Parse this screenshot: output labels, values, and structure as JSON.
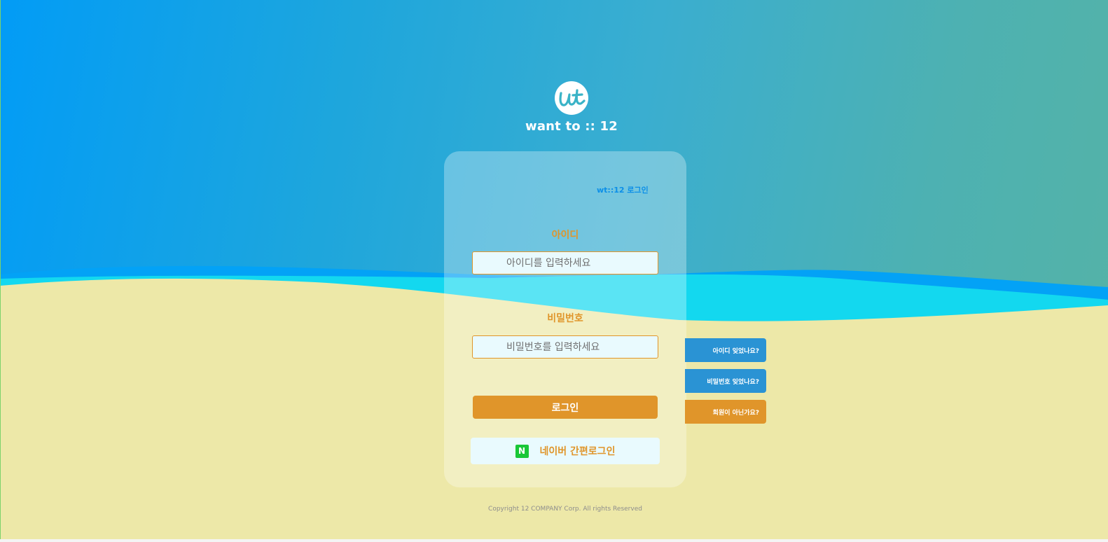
{
  "brand": {
    "logo_text": "wt",
    "name": "want to :: 12"
  },
  "login_card": {
    "title": "wt::12 로그인",
    "id_label": "아이디",
    "id_placeholder": "아이디를 입력하세요",
    "password_label": "비밀번호",
    "password_placeholder": "비밀번호를 입력하세요",
    "login_button": "로그인",
    "naver_icon": "N",
    "naver_button": "네이버 간편로그인"
  },
  "side_links": {
    "find_id": "아이디 잊었나요?",
    "find_password": "비밀번호 잊었나요?",
    "signup": "회원이 아닌가요?"
  },
  "footer": {
    "copyright": "Copyright 12 COMPANY Corp. All rights Reserved"
  },
  "colors": {
    "accent_orange": "#e0952a",
    "accent_blue": "#2a93d4",
    "title_blue": "#0c8fe8",
    "sand": "#ede8a8",
    "naver_green": "#19c737"
  }
}
